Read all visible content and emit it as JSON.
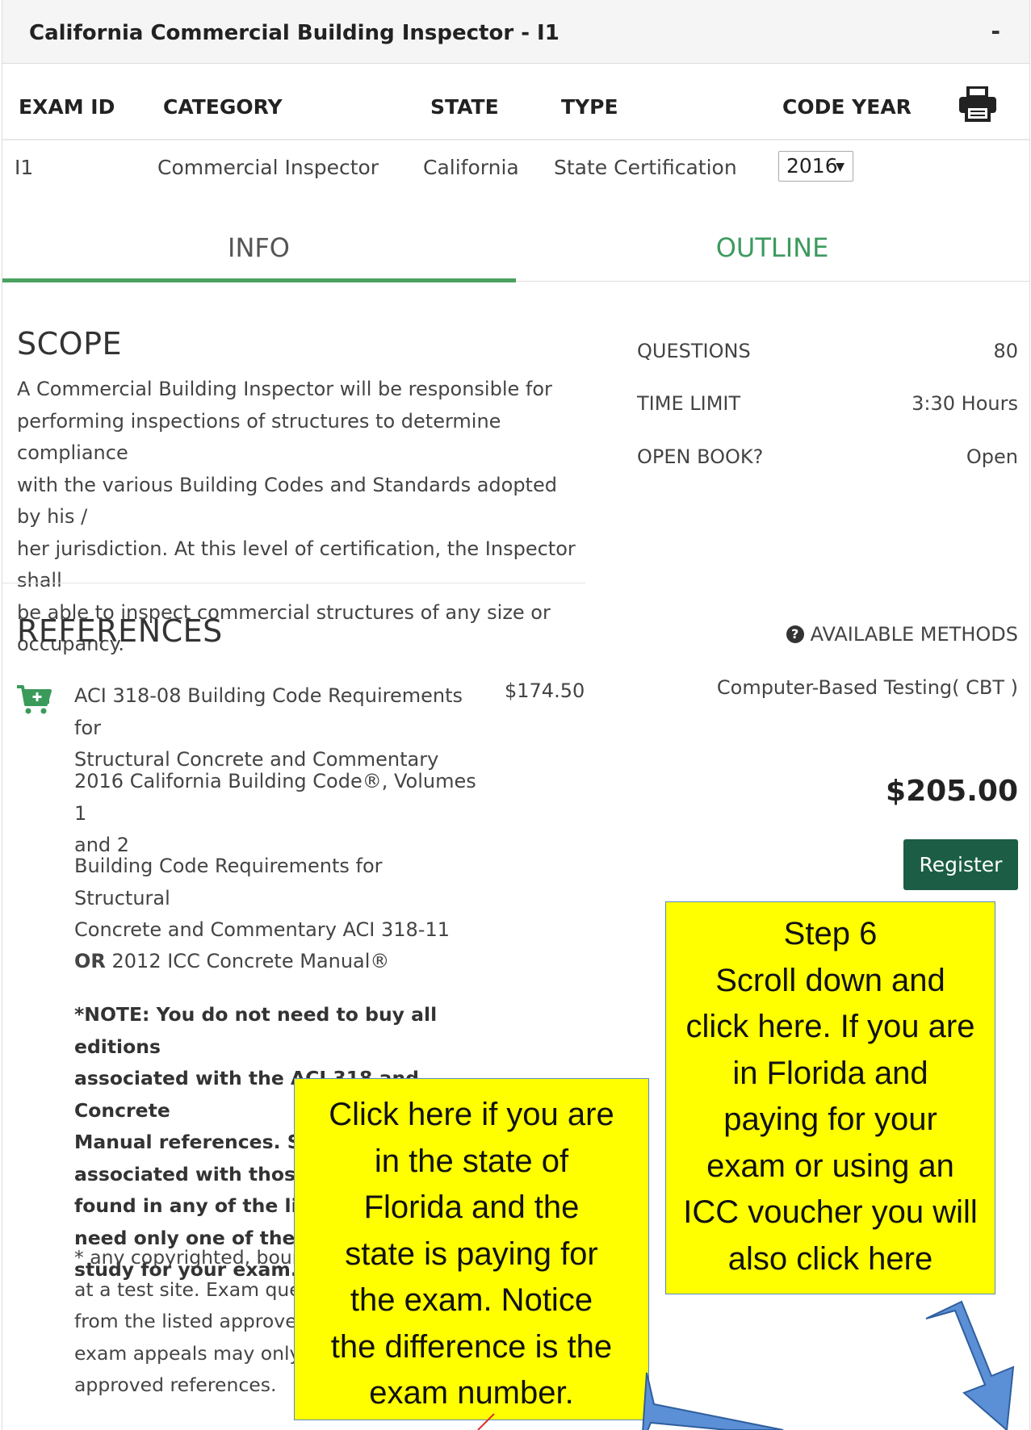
{
  "panel": {
    "title": "California Commercial Building Inspector - I1",
    "collapse_label": "-"
  },
  "table": {
    "headers": {
      "exam_id": "EXAM ID",
      "category": "CATEGORY",
      "state": "STATE",
      "type": "TYPE",
      "code_year": "CODE YEAR"
    },
    "row": {
      "exam_id": "I1",
      "category": "Commercial Inspector",
      "state": "California",
      "type": "State Certification",
      "code_year": "2016"
    },
    "print_icon": "printer-icon"
  },
  "tabs": {
    "info": "INFO",
    "outline": "OUTLINE",
    "active": "info"
  },
  "scope": {
    "title": "SCOPE",
    "lines": [
      "A Commercial Building Inspector will be responsible for",
      "performing inspections of structures to determine compliance",
      "with the various Building Codes and Standards adopted by his /",
      "her jurisdiction. At this level of certification, the Inspector shall",
      "be able to inspect commercial structures of any size or",
      "occupancy."
    ]
  },
  "stats": {
    "questions_label": "QUESTIONS",
    "questions": "80",
    "time_limit_label": "TIME LIMIT",
    "time_limit": "3:30 Hours",
    "open_book_label": "OPEN BOOK?",
    "open_book": "Open"
  },
  "references": {
    "title": "REFERENCES",
    "cart_icon": "add-to-cart-icon",
    "ref1_line1": "ACI 318-08 Building Code Requirements for",
    "ref1_line2": "Structural Concrete and Commentary",
    "ref1_price": "$174.50",
    "ref2_line1": "2016 California Building Code®, Volumes 1",
    "ref2_line2": "and 2",
    "ref3_line1": "Building Code Requirements for Structural",
    "ref3_line2": "Concrete and Commentary ACI 318-11",
    "ref4_or": "OR",
    "ref4_text": " 2012 ICC Concrete Manual®",
    "note_lines": [
      "*NOTE: You do not need to buy all editions",
      "associated with the ACI 318 and Concrete",
      "Manual references. Since all answers",
      "associated with those re",
      "found in any of the listed",
      "need only one of the ref",
      "study for your exam."
    ],
    "copy_lines": [
      "* any copyrighted, bound",
      "at a test site. Exam questi",
      "from the listed approved",
      "exam appeals may only b",
      "approved references."
    ]
  },
  "methods": {
    "header": "AVAILABLE METHODS",
    "help_icon": "question-circle-icon",
    "method": "Computer-Based Testing( CBT )",
    "price": "$205.00",
    "register": "Register"
  },
  "callouts": {
    "right_lines": [
      "Step 6",
      "Scroll down and",
      "click here. If you are",
      "in Florida and",
      "paying for your",
      "exam or using an",
      "ICC voucher you will",
      "also click here"
    ],
    "left_lines": [
      "Click here if you are",
      "in the state of",
      "Florida and the",
      "state is paying for",
      "the exam. Notice",
      "the difference is the",
      "exam number."
    ],
    "arrow_color": "#5b8fd6",
    "highlight_color": "#ffff00"
  }
}
